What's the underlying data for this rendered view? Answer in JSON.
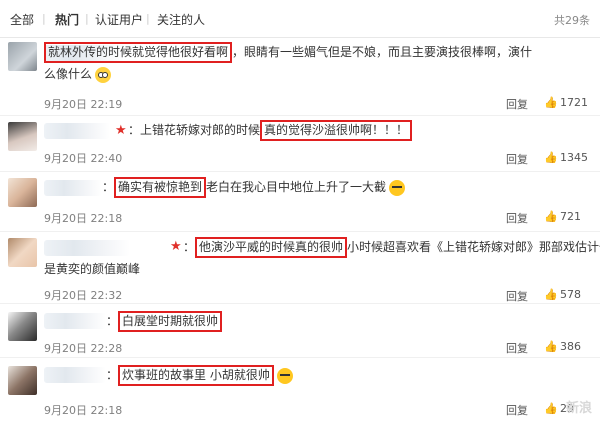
{
  "tabs": {
    "items": [
      {
        "label": "全部"
      },
      {
        "label": "热门"
      },
      {
        "label": "认证用户"
      },
      {
        "label": "关注的人"
      }
    ],
    "separator": "|",
    "total": "共29条"
  },
  "actions": {
    "reply_label": "回复",
    "like_icon": "thumbs-up-icon"
  },
  "comments": [
    {
      "highlight": "就林外传的时候就觉得他很好看啊",
      "rest": "，眼睛有一些媚气但是不娘，而且主要演技很棒啊，演什",
      "line2": "么像什么",
      "time": "9月20日 22:19",
      "likes": "1721"
    },
    {
      "prefix": "：上错花轿嫁对郎的时候",
      "highlight": "真的觉得沙溢很帅啊！！！",
      "rest": "",
      "time": "9月20日 22:40",
      "likes": "1345"
    },
    {
      "prefix": "：",
      "highlight": "确实有被惊艳到",
      "rest": "老白在我心目中地位上升了一大截",
      "time": "9月20日 22:18",
      "likes": "721"
    },
    {
      "prefix": "：",
      "highlight": "他演沙平威的时候真的很帅",
      "rest": "小时候超喜欢看《上错花轿嫁对郎》那部戏估计也",
      "line2": "是黄奕的颜值巅峰",
      "time": "9月20日 22:32",
      "likes": "578"
    },
    {
      "prefix": "：",
      "highlight": "白展堂时期就很帅",
      "rest": "",
      "time": "9月20日 22:28",
      "likes": "386"
    },
    {
      "prefix": "：",
      "highlight": "炊事班的故事里 小胡就很帅",
      "rest": "",
      "time": "9月20日 22:18",
      "likes": "29"
    }
  ],
  "watermark": "新浪"
}
